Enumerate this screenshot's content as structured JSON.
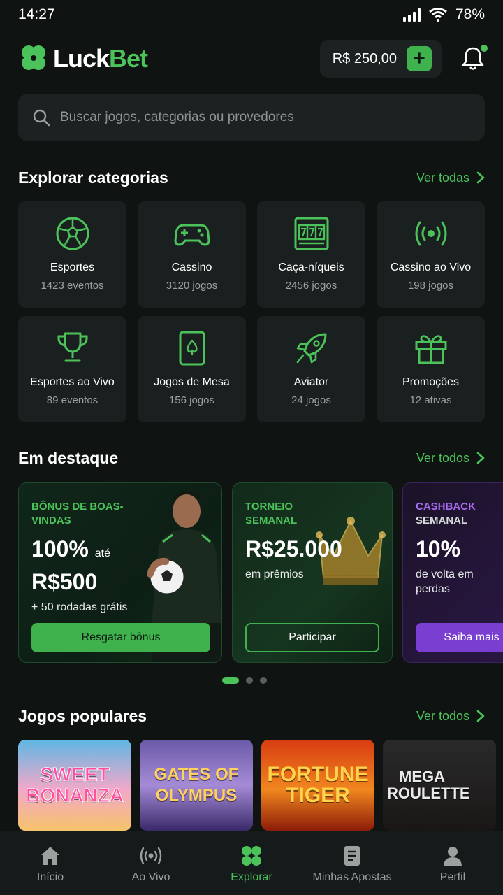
{
  "status": {
    "time": "14:27",
    "battery": "78%"
  },
  "header": {
    "logo_luck": "Luck",
    "logo_bet": "Bet",
    "balance": "R$ 250,00",
    "add_label": "+"
  },
  "search": {
    "placeholder": "Buscar jogos, categorias ou provedores"
  },
  "categories_section": {
    "title": "Explorar categorias",
    "see_all": "Ver todas"
  },
  "categories": [
    {
      "name": "Esportes",
      "count": "1423 eventos",
      "icon": "soccer-ball-icon"
    },
    {
      "name": "Cassino",
      "count": "3120 jogos",
      "icon": "gamepad-icon"
    },
    {
      "name": "Caça-níqueis",
      "count": "2456 jogos",
      "icon": "slot-machine-icon"
    },
    {
      "name": "Cassino ao Vivo",
      "count": "198 jogos",
      "icon": "live-broadcast-icon"
    },
    {
      "name": "Esportes ao Vivo",
      "count": "89 eventos",
      "icon": "trophy-icon"
    },
    {
      "name": "Jogos de Mesa",
      "count": "156 jogos",
      "icon": "playing-card-icon"
    },
    {
      "name": "Aviator",
      "count": "24 jogos",
      "icon": "rocket-icon"
    },
    {
      "name": "Promoções",
      "count": "12 ativas",
      "icon": "gift-icon"
    }
  ],
  "featured_section": {
    "title": "Em destaque",
    "see_all": "Ver todos"
  },
  "promos": [
    {
      "kicker": "BÔNUS DE BOAS-VINDAS",
      "big1": "100%",
      "big1_small": "até",
      "big2": "R$500",
      "sub": "+ 50 rodadas grátis",
      "button": "Resgatar bônus"
    },
    {
      "kicker": "TORNEIO SEMANAL",
      "big1": "R$25.000",
      "sub": "em prêmios",
      "button": "Participar"
    },
    {
      "kicker_a": "CASHBACK",
      "kicker_b": "SEMANAL",
      "big1": "10%",
      "sub": "de volta em perdas",
      "button": "Saiba mais"
    }
  ],
  "popular_section": {
    "title": "Jogos populares",
    "see_all": "Ver todos"
  },
  "games": [
    {
      "title": "SWEET BONANZA"
    },
    {
      "title": "GATES OF OLYMPUS"
    },
    {
      "title": "FORTUNE TIGER"
    },
    {
      "title": "MEGA ROULETTE"
    }
  ],
  "nav": [
    {
      "label": "Início",
      "icon": "home-icon"
    },
    {
      "label": "Ao Vivo",
      "icon": "live-icon"
    },
    {
      "label": "Explorar",
      "icon": "explore-grid-icon",
      "active": true
    },
    {
      "label": "Minhas Apostas",
      "icon": "bets-receipt-icon"
    },
    {
      "label": "Perfil",
      "icon": "user-icon"
    }
  ],
  "colors": {
    "accent": "#4cc35a",
    "background": "#0f1413",
    "card": "#1a201f",
    "purple": "#7a3fd1"
  }
}
